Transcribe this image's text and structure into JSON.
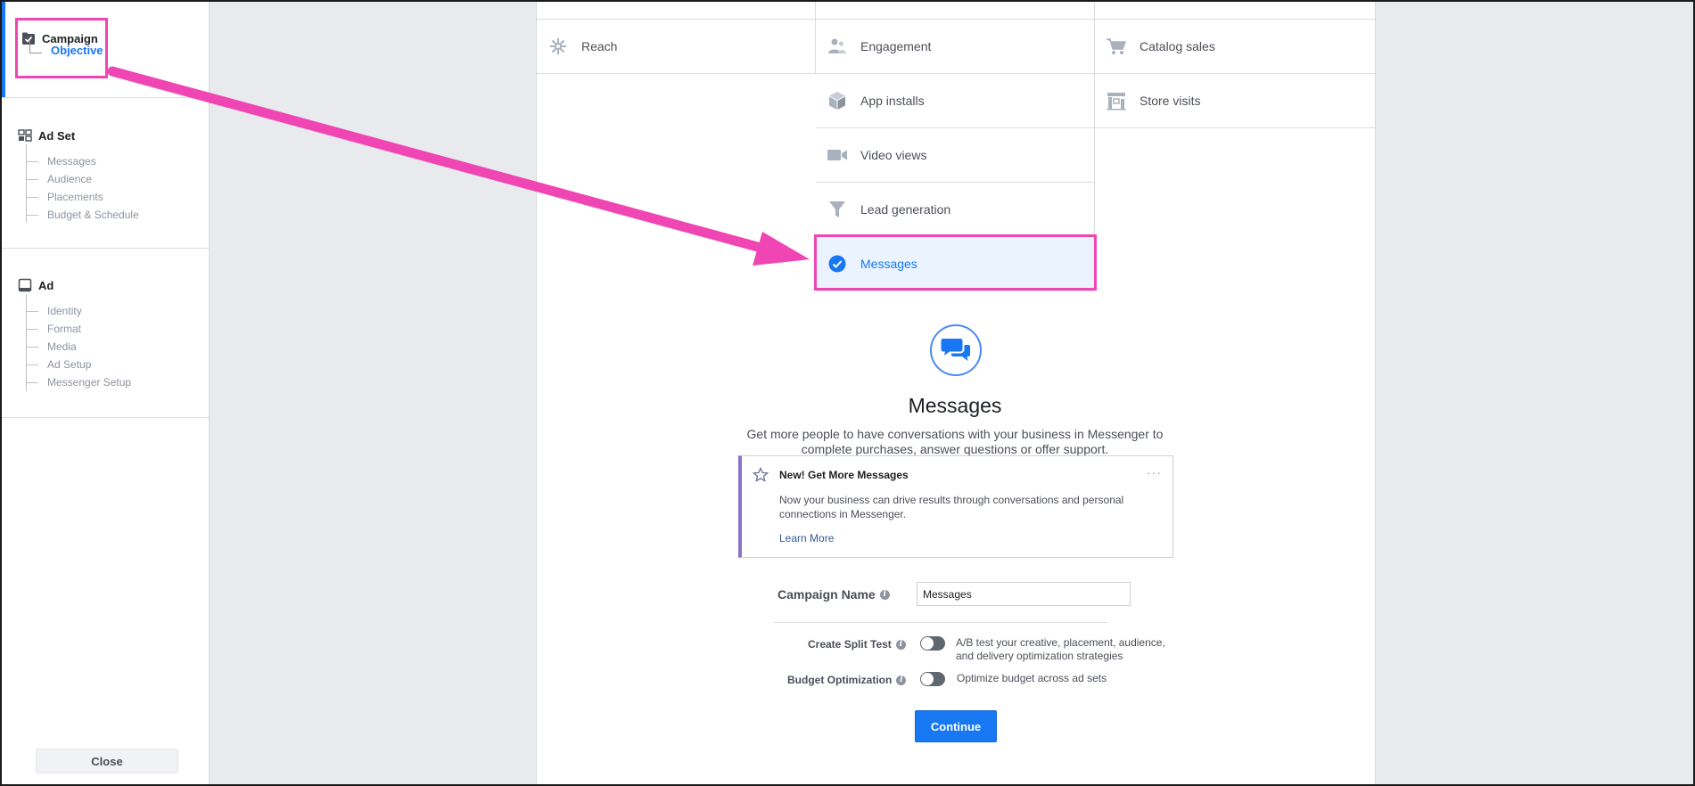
{
  "sidebar": {
    "campaign": {
      "label": "Campaign",
      "items": [
        {
          "label": "Objective"
        }
      ]
    },
    "adset": {
      "label": "Ad Set",
      "items": [
        {
          "label": "Messages"
        },
        {
          "label": "Audience"
        },
        {
          "label": "Placements"
        },
        {
          "label": "Budget & Schedule"
        }
      ]
    },
    "ad": {
      "label": "Ad",
      "items": [
        {
          "label": "Identity"
        },
        {
          "label": "Format"
        },
        {
          "label": "Media"
        },
        {
          "label": "Ad Setup"
        },
        {
          "label": "Messenger Setup"
        }
      ]
    },
    "close_label": "Close"
  },
  "objectives": {
    "reach": "Reach",
    "engagement": "Engagement",
    "catalog_sales": "Catalog sales",
    "app_installs": "App installs",
    "store_visits": "Store visits",
    "video_views": "Video views",
    "lead_generation": "Lead generation",
    "messages": "Messages"
  },
  "selected_objective": {
    "title": "Messages",
    "description": "Get more people to have conversations with your business in Messenger to complete purchases, answer questions or offer support."
  },
  "promo": {
    "title": "New! Get More Messages",
    "more": "···",
    "body": "Now your business can drive results through conversations and personal connections in Messenger.",
    "link": "Learn More"
  },
  "form": {
    "campaign_name_label": "Campaign Name",
    "campaign_name_value": "Messages",
    "split_test_label": "Create Split Test",
    "split_test_desc": "A/B test your creative, placement, audience, and delivery optimization strategies",
    "budget_opt_label": "Budget Optimization",
    "budget_opt_desc": "Optimize budget across ad sets",
    "info_glyph": "i",
    "continue_label": "Continue"
  },
  "colors": {
    "accent": "#1877f2",
    "highlight": "#f046b4",
    "promo_bar": "#8c72cb"
  }
}
